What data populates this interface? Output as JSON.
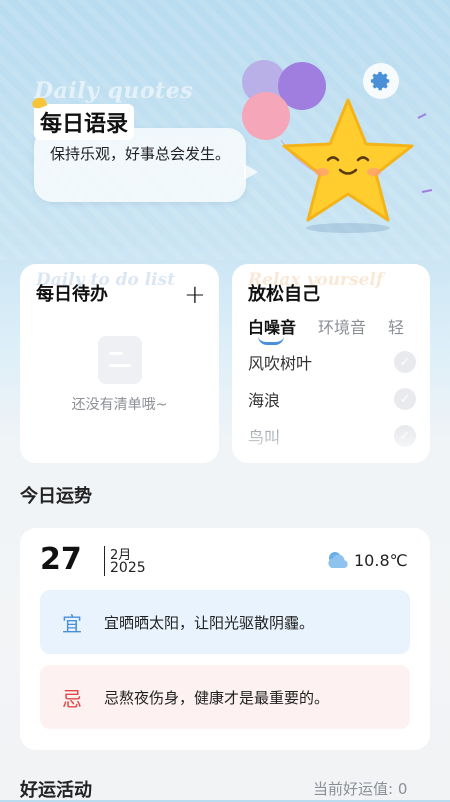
{
  "hero": {
    "ghost_title": "Daily quotes",
    "title": "每日语录",
    "quote": "保持乐观，好事总会发生。"
  },
  "todo": {
    "ghost_title": "Daily to do list",
    "title": "每日待办",
    "add_label": "+",
    "empty_text": "还没有清单哦~"
  },
  "relax": {
    "ghost_title": "Relax yourself",
    "title": "放松自己",
    "tabs": [
      "白噪音",
      "环境音",
      "轻"
    ],
    "sounds": [
      {
        "name": "风吹树叶"
      },
      {
        "name": "海浪"
      },
      {
        "name": "鸟叫"
      }
    ]
  },
  "fortune": {
    "section_title": "今日运势",
    "day": "27",
    "month": "2月",
    "year": "2025",
    "temperature": "10.8℃",
    "weather_icon": "partly-cloudy-icon",
    "yi_label": "宜",
    "yi_text": "宜晒晒太阳，让阳光驱散阴霾。",
    "ji_label": "忌",
    "ji_text": "忌熬夜伤身，健康才是最重要的。"
  },
  "activity": {
    "section_title": "好运活动",
    "luck_value": "当前好运值: 0"
  },
  "colors": {
    "accent": "#4a90d9",
    "warning": "#e34848"
  }
}
